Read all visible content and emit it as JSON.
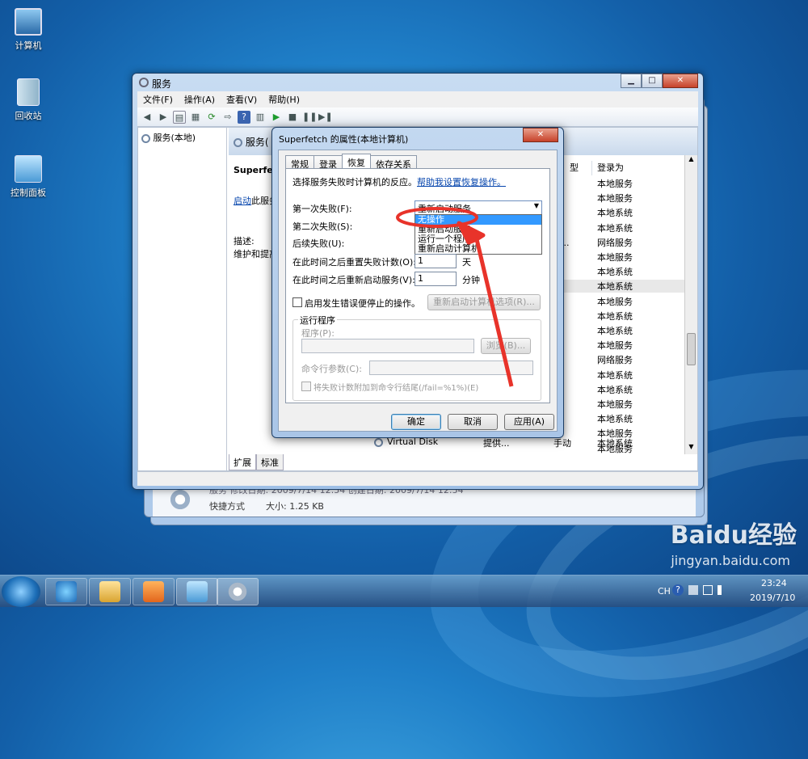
{
  "desktop": {
    "icons": [
      {
        "label": "计算机"
      },
      {
        "label": "回收站"
      },
      {
        "label": "控制面板"
      }
    ]
  },
  "services_window": {
    "title": "服务",
    "caption": {
      "minimize": "▁",
      "maximize": "□",
      "close": "✕"
    },
    "menu": [
      "文件(F)",
      "操作(A)",
      "查看(V)",
      "帮助(H)"
    ],
    "tree_item": "服务(本地)",
    "header": "服务(",
    "detail": {
      "name": "Superfetch",
      "start_link": "启动",
      "start_text": "此服务",
      "desc_label": "描述:",
      "desc_text": "维护和提高"
    },
    "columns": [
      "型",
      "登录为"
    ],
    "rows": [
      {
        "status": "",
        "login": "本地服务"
      },
      {
        "status": "",
        "login": "本地服务"
      },
      {
        "status": "",
        "login": "本地系统"
      },
      {
        "status": "",
        "login": "本地系统"
      },
      {
        "status": "迟...",
        "login": "网络服务"
      },
      {
        "status": "",
        "login": "本地服务"
      },
      {
        "status": "",
        "login": "本地系统"
      },
      {
        "status": "",
        "login": "本地系统"
      },
      {
        "status": "",
        "login": "本地服务"
      },
      {
        "status": "",
        "login": "本地系统"
      },
      {
        "status": "",
        "login": "本地系统"
      },
      {
        "status": "",
        "login": "本地服务"
      },
      {
        "status": "",
        "login": "网络服务"
      },
      {
        "status": "",
        "login": "本地系统"
      },
      {
        "status": "",
        "login": "本地系统"
      },
      {
        "status": "",
        "login": "本地服务"
      },
      {
        "status": "",
        "login": "本地系统"
      },
      {
        "status": "",
        "login": "本地服务"
      },
      {
        "status": "",
        "login": "本地服务"
      }
    ],
    "last_row": {
      "name": "Virtual Disk",
      "desc": "提供...",
      "startup": "手动",
      "login": "本地系统"
    },
    "bottom_tabs": [
      "扩展",
      "标准"
    ]
  },
  "back_window": {
    "info_line": "服务   修改日期: 2009/7/14 12:54   创建日期: 2009/7/14 12:54",
    "shortcut": "快捷方式",
    "size": "大小: 1.25 KB"
  },
  "dialog": {
    "title": "Superfetch 的属性(本地计算机)",
    "close": "✕",
    "tabs": [
      "常规",
      "登录",
      "恢复",
      "依存关系"
    ],
    "active_tab": "恢复",
    "intro": "选择服务失败时计算机的反应。",
    "help_link": "帮助我设置恢复操作。",
    "first_fail": "第一次失败(F):",
    "second_fail": "第二次失败(S):",
    "later_fail": "后续失败(U):",
    "dropdown_value": "重新启动服务",
    "dropdown_options": [
      "无操作",
      "重新启动服务",
      "运行一个程序",
      "重新启动计算机"
    ],
    "selected_option": "无操作",
    "reset_label": "在此时间之后重置失败计数(O):",
    "reset_value": "1",
    "reset_unit": "天",
    "restart_label": "在此时间之后重新启动服务(V):",
    "restart_value": "1",
    "restart_unit": "分钟",
    "enable_actions": "启用发生错误便停止的操作。",
    "restart_options_btn": "重新启动计算机选项(R)...",
    "run_group": "运行程序",
    "program_label": "程序(P):",
    "browse_btn": "浏览(B)...",
    "params_label": "命令行参数(C):",
    "append_label": "将失败计数附加到命令行结尾(/fail=%1%)(E)",
    "ok": "确定",
    "cancel": "取消",
    "apply": "应用(A)"
  },
  "taskbar": {
    "lang": "CH",
    "time": "23:24",
    "date": "2019/7/10"
  },
  "watermark": {
    "brand": "Baidu经验",
    "url": "jingyan.baidu.com"
  },
  "colors": {
    "highlight": "#3399ff",
    "annotation": "#e8332a",
    "link": "#0645ad"
  }
}
